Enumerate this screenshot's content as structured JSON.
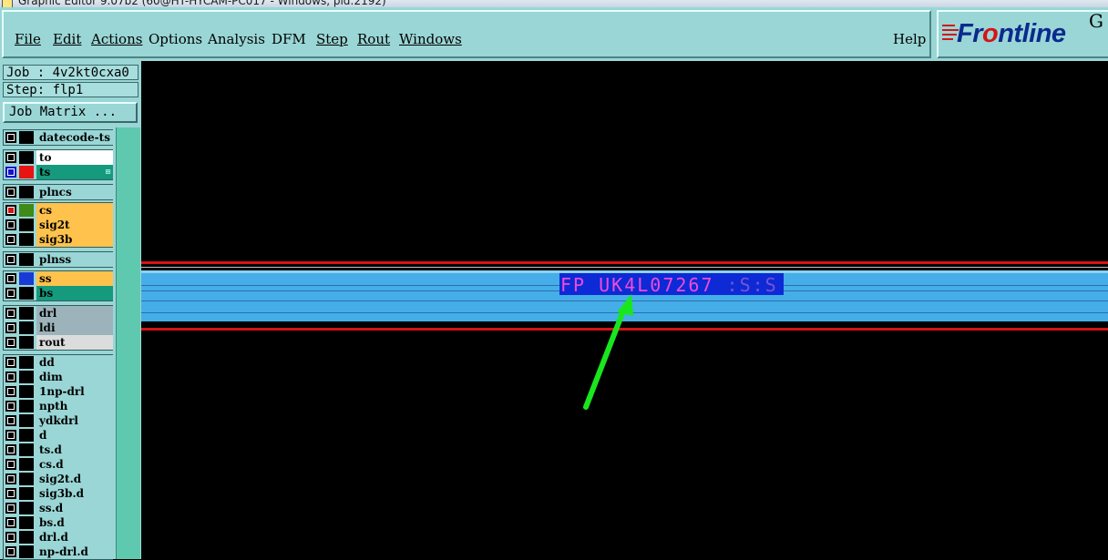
{
  "window": {
    "title": "Graphic Editor 9.07b2 (60@HT-HYCAM-PC017 - Windows, pid:2192)"
  },
  "menu": {
    "items": [
      {
        "label": "File"
      },
      {
        "label": "Edit"
      },
      {
        "label": "Actions"
      },
      {
        "label": "Options"
      },
      {
        "label": "Analysis"
      },
      {
        "label": "DFM"
      },
      {
        "label": "Step"
      },
      {
        "label": "Rout"
      },
      {
        "label": "Windows"
      }
    ],
    "help": "Help"
  },
  "logo": {
    "brand": "Frontline",
    "brand_pre": "Fr",
    "brand_post": "ntline",
    "extra": "G"
  },
  "job": {
    "job_line": "Job : 4v2kt0cxa0",
    "step_line": "Step: flp1"
  },
  "job_matrix_button": "Job Matrix ...",
  "layers": [
    {
      "name": "datecode-ts",
      "color": "#9ad6d6"
    },
    {
      "name": "to",
      "color": "#ffffff"
    },
    {
      "name": "ts",
      "color": "#159a7e",
      "swatch": "#e81414",
      "active": true
    },
    {
      "name": "plncs",
      "color": "#9ad6d6"
    },
    {
      "name": "cs",
      "color": "#ffc24d",
      "swatch": "#3f8a18",
      "checked_red": true
    },
    {
      "name": "sig2t",
      "color": "#ffc24d"
    },
    {
      "name": "sig3b",
      "color": "#ffc24d"
    },
    {
      "name": "plnss",
      "color": "#9ad6d6"
    },
    {
      "name": "ss",
      "color": "#ffc24d",
      "swatch": "#1a3ad6"
    },
    {
      "name": "bs",
      "color": "#159a7e"
    },
    {
      "name": "drl",
      "color": "#9cb3bb"
    },
    {
      "name": "ldi",
      "color": "#9cb3bb"
    },
    {
      "name": "rout",
      "color": "#dcdcdc"
    },
    {
      "name": "dd",
      "color": "#9ad6d6"
    },
    {
      "name": "dim",
      "color": "#9ad6d6"
    },
    {
      "name": "1np-drl",
      "color": "#9ad6d6"
    },
    {
      "name": "npth",
      "color": "#9ad6d6"
    },
    {
      "name": "ydkdrl",
      "color": "#9ad6d6"
    },
    {
      "name": "d",
      "color": "#9ad6d6"
    },
    {
      "name": "ts.d",
      "color": "#9ad6d6"
    },
    {
      "name": "cs.d",
      "color": "#9ad6d6"
    },
    {
      "name": "sig2t.d",
      "color": "#9ad6d6"
    },
    {
      "name": "sig3b.d",
      "color": "#9ad6d6"
    },
    {
      "name": "ss.d",
      "color": "#9ad6d6"
    },
    {
      "name": "bs.d",
      "color": "#9ad6d6"
    },
    {
      "name": "drl.d",
      "color": "#9ad6d6"
    },
    {
      "name": "np-drl.d",
      "color": "#9ad6d6"
    }
  ],
  "canvas": {
    "label_text": "FP UK4L07267",
    "label_suffix": ":S:S",
    "colors": {
      "background": "#000000",
      "trace_red": "#d41414",
      "band_blue": "#45aee8",
      "highlight": "#0d2ad6",
      "text_magenta": "#f14ad8",
      "arrow_green": "#19e61e"
    }
  }
}
